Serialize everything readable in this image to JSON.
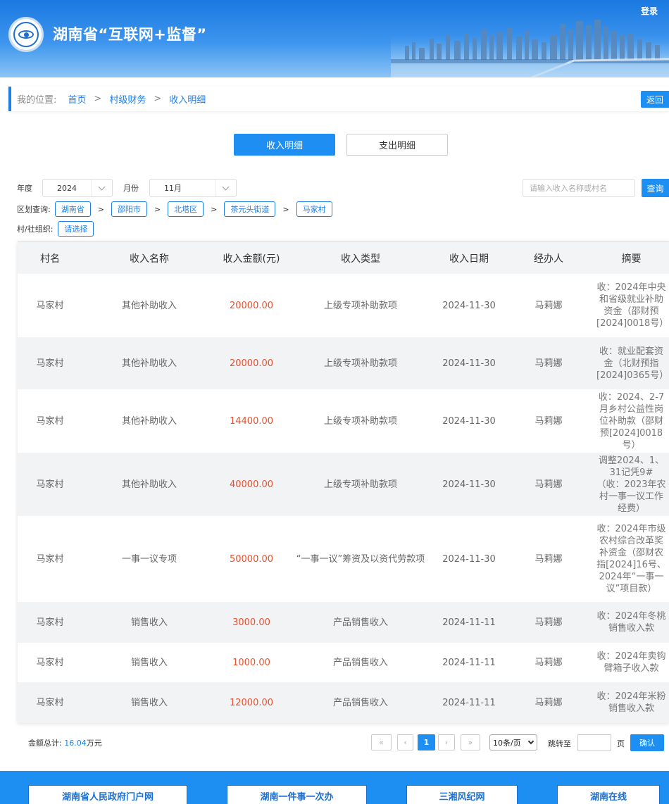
{
  "header": {
    "title": "湖南省“互联网+监督”",
    "login": "登录",
    "logo_icon": "eye-emblem-icon"
  },
  "breadcrumb": {
    "location_label": "我的位置:",
    "items": [
      "首页",
      "村级财务",
      "收入明细"
    ],
    "separator": ">",
    "back": "返回"
  },
  "tabs": [
    {
      "label": "收入明细",
      "active": true
    },
    {
      "label": "支出明细",
      "active": false
    }
  ],
  "filters": {
    "year_label": "年度",
    "year_value": "2024",
    "month_label": "月份",
    "month_value": "11月",
    "search_placeholder": "请输入收入名称或村名",
    "search_button": "查询",
    "region_label": "区划查询:",
    "regions": [
      "湖南省",
      "邵阳市",
      "北塔区",
      "茶元头街道",
      "马家村"
    ],
    "region_separator": ">",
    "org_label": "村/社组织:",
    "org_value": "请选择"
  },
  "table": {
    "columns": [
      "村名",
      "收入名称",
      "收入金额(元)",
      "收入类型",
      "收入日期",
      "经办人",
      "摘要"
    ],
    "rows": [
      {
        "village": "马家村",
        "name": "其他补助收入",
        "amount": "20000.00",
        "type": "上级专项补助款项",
        "date": "2024-11-30",
        "handler": "马莉娜",
        "summary": "收：2024年中央和省级就业补助资金（邵财预[2024]0018号）"
      },
      {
        "village": "马家村",
        "name": "其他补助收入",
        "amount": "20000.00",
        "type": "上级专项补助款项",
        "date": "2024-11-30",
        "handler": "马莉娜",
        "summary": "收：就业配套资金（北财预指[2024]0365号）"
      },
      {
        "village": "马家村",
        "name": "其他补助收入",
        "amount": "14400.00",
        "type": "上级专项补助款项",
        "date": "2024-11-30",
        "handler": "马莉娜",
        "summary": "收：2024、2-7月乡村公益性岗位补助款（邵财预[2024]0018号）"
      },
      {
        "village": "马家村",
        "name": "其他补助收入",
        "amount": "40000.00",
        "type": "上级专项补助款项",
        "date": "2024-11-30",
        "handler": "马莉娜",
        "summary": "调整2024、1、31记凭9#（收：2023年农村一事一议工作经费）"
      },
      {
        "village": "马家村",
        "name": "一事一议专项",
        "amount": "50000.00",
        "type": "“一事一议”筹资及以资代劳款项",
        "date": "2024-11-30",
        "handler": "马莉娜",
        "summary": "收：2024年市级农村综合改革奖补资金（邵财农指[2024]16号、2024年“一事一议”项目款）"
      },
      {
        "village": "马家村",
        "name": "销售收入",
        "amount": "3000.00",
        "type": "产品销售收入",
        "date": "2024-11-11",
        "handler": "马莉娜",
        "summary": "收：2024年冬桃销售收入款"
      },
      {
        "village": "马家村",
        "name": "销售收入",
        "amount": "1000.00",
        "type": "产品销售收入",
        "date": "2024-11-11",
        "handler": "马莉娜",
        "summary": "收：2024年卖钩臂箱子收入款"
      },
      {
        "village": "马家村",
        "name": "销售收入",
        "amount": "12000.00",
        "type": "产品销售收入",
        "date": "2024-11-11",
        "handler": "马莉娜",
        "summary": "收：2024年米粉销售收入款"
      }
    ]
  },
  "summary": {
    "total_label": "金额总计:",
    "total_value": "16.04",
    "total_unit": "万元"
  },
  "pagination": {
    "current_page": "1",
    "page_size": "10条/页",
    "jump_label": "跳转至",
    "page_unit": "页",
    "confirm": "确认"
  },
  "footer_links": [
    "湖南省人民政府门户网",
    "湖南一件事一次办",
    "三湘风纪网",
    "湖南在线"
  ],
  "colors": {
    "primary": "#1d8ef2",
    "amount": "#e9502d",
    "header_gradient_top": "#1a78e0"
  }
}
